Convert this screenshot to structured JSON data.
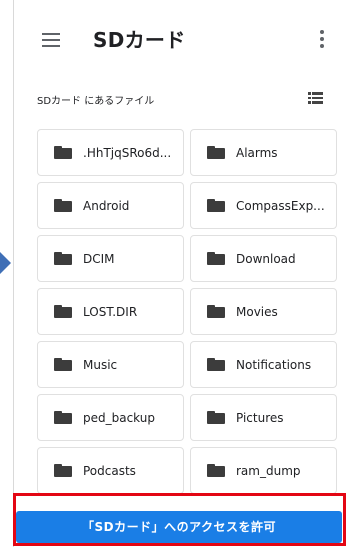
{
  "app": {
    "title": "SDカード",
    "menu_icon": "menu-icon",
    "more_icon": "more-vert-icon"
  },
  "section": {
    "subtitle": "SDカード にあるファイル",
    "view_toggle_icon": "list-view-icon"
  },
  "folders": [
    {
      "name": ".HhTjqSRo6d..."
    },
    {
      "name": "Alarms"
    },
    {
      "name": "Android"
    },
    {
      "name": "CompassExp..."
    },
    {
      "name": "DCIM"
    },
    {
      "name": "Download"
    },
    {
      "name": "LOST.DIR"
    },
    {
      "name": "Movies"
    },
    {
      "name": "Music"
    },
    {
      "name": "Notifications"
    },
    {
      "name": "ped_backup"
    },
    {
      "name": "Pictures"
    },
    {
      "name": "Podcasts"
    },
    {
      "name": "ram_dump"
    }
  ],
  "action": {
    "allow_label": "「SDカード」へのアクセスを許可"
  },
  "colors": {
    "accent": "#1a7ee6",
    "highlight": "#e30613",
    "indicator": "#3f6fb6"
  }
}
